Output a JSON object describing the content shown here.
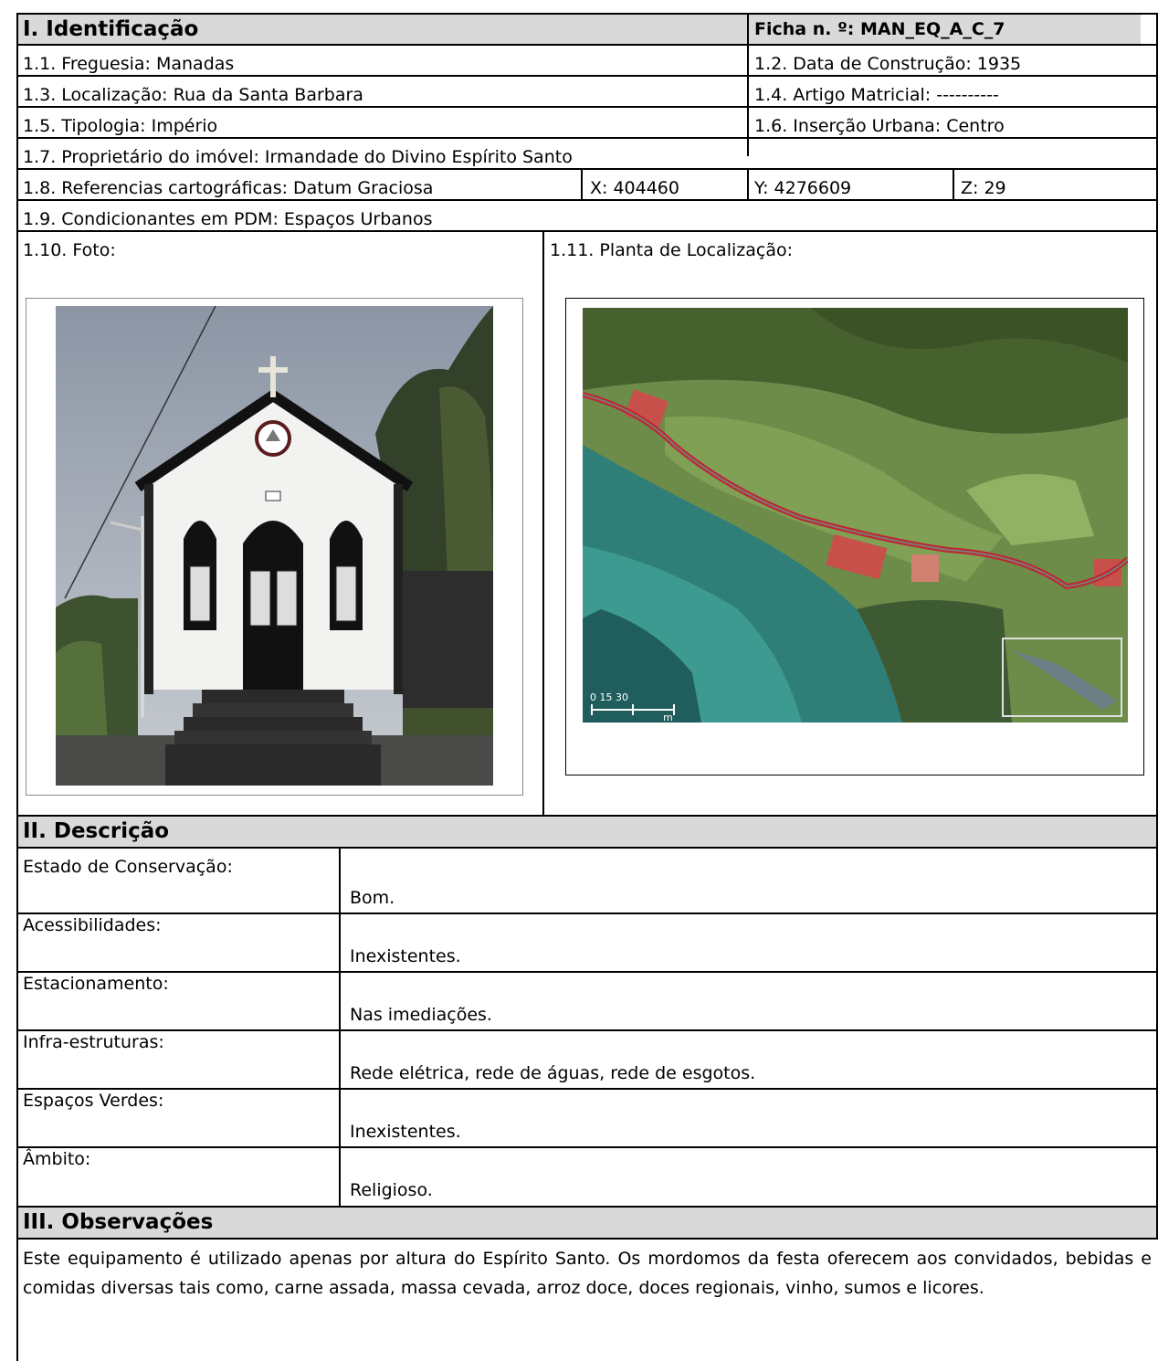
{
  "identificacao": {
    "title": "I. Identificação",
    "ficha": "Ficha n. º: MAN_EQ_A_C_7",
    "freguesia": "1.1. Freguesia: Manadas",
    "data_construcao": "1.2. Data de Construção: 1935",
    "localizacao": "1.3. Localização: Rua da Santa Barbara",
    "artigo_matricial": "1.4. Artigo Matricial: ----------",
    "tipologia": "1.5. Tipologia: Império",
    "insercao_urbana": "1.6. Inserção Urbana: Centro",
    "proprietario": "1.7. Proprietário do imóvel: Irmandade do Divino Espírito Santo",
    "referencias": "1.8. Referencias cartográficas: Datum Graciosa",
    "x": "X: 404460",
    "y": "Y: 4276609",
    "z": "Z: 29",
    "condicionantes": "1.9. Condicionantes em PDM: Espaços Urbanos",
    "foto_label": "1.10. Foto:",
    "planta_label": "1.11. Planta de Localização:",
    "map_scale": "0   15   30",
    "map_scale_unit": "m"
  },
  "descricao": {
    "title": "II. Descrição",
    "rows": [
      {
        "label": "Estado de Conservação:",
        "value": "Bom."
      },
      {
        "label": "Acessibilidades:",
        "value": "Inexistentes."
      },
      {
        "label": "Estacionamento:",
        "value": "Nas imediações."
      },
      {
        "label": "Infra-estruturas:",
        "value": "Rede elétrica, rede de águas, rede de esgotos."
      },
      {
        "label": "Espaços Verdes:",
        "value": "Inexistentes."
      },
      {
        "label": "Âmbito:",
        "value": "Religioso."
      }
    ]
  },
  "observacoes": {
    "title": "III. Observações",
    "text": "Este equipamento é utilizado apenas por altura do Espírito Santo. Os mordomos da festa oferecem aos convidados, bebidas e comidas diversas tais como, carne assada, massa cevada, arroz doce, doces regionais, vinho, sumos e licores."
  },
  "colors": {
    "header_bg": "#d9d9d9",
    "border": "#000000"
  }
}
